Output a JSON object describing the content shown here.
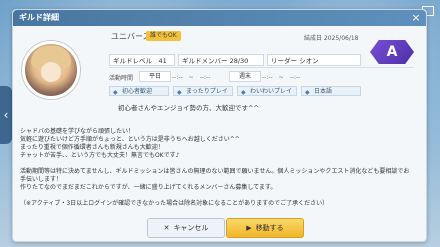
{
  "window": {
    "title": "ギルド詳細",
    "close_icon": "×"
  },
  "guild": {
    "name": "ユニバース",
    "badge": "誰でもOK",
    "created_label": "結成日 2025/06/18",
    "rank_letter": "A",
    "stats": {
      "level": "ギルドレベル　41",
      "members": "ギルドメンバー 28/30",
      "leader": "リーダー シオン"
    },
    "activity": {
      "label": "活動時間",
      "weekday_label": "平日",
      "weekday_value": "--:--　~　--:--",
      "weekend_label": "週末",
      "weekend_value": "--:--　~　--:--"
    },
    "tags": [
      "初心者歓迎",
      "まったりプレイ",
      "わいわいプレイ",
      "日本語"
    ],
    "message": "初心者さんやエンジョイ勢の方、大歓迎です^^"
  },
  "description": {
    "lines": [
      "シャドバの基礎を学びながら頑張したい！",
      "気軽に遊びたいけど方手順がちょっと、という方は是非うちへお越しください^^",
      "まったり重視で個作循環者さんも新規さんも大歓迎！",
      "チャットが苦手、、という方でも大丈夫！無言でもOKです♪",
      "",
      "活動期間等は特に決めてませんし、ギルドミッションは皆さんの無理のない範囲で願いません。個人ミッションやクエスト消化なども要相談でお手伝いします！",
      "作りたてなのでまだまだこれからですが、一緒に盛り上げてくれるメンバーさん募集してます。",
      "",
      "（※アクティブ・3日以上ログインが確認できなかった場合は除名対象になることがありますのでご了承ください）"
    ]
  },
  "buttons": {
    "cancel": "キャンセル",
    "move": "移動する"
  }
}
